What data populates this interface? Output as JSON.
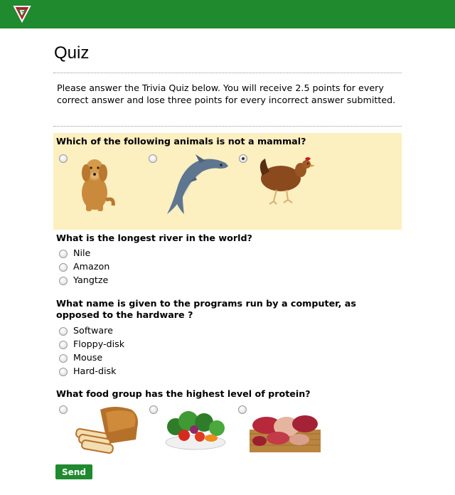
{
  "header": {
    "brand_color": "#1f8a2e",
    "logo_icon": "shield-logo-icon"
  },
  "page": {
    "title": "Quiz",
    "intro": "Please answer the Trivia Quiz below. You will receive 2.5 points for every correct answer and lose three points for every incorrect answer submitted."
  },
  "questions": [
    {
      "text": "Which of the following animals is not a mammal?",
      "options": [
        {
          "picture": "dog-image",
          "selected": false
        },
        {
          "picture": "dolphin-image",
          "selected": false
        },
        {
          "picture": "chicken-image",
          "selected": true
        }
      ]
    },
    {
      "text": "What is the longest river in the world?",
      "options": [
        {
          "label": "Nile"
        },
        {
          "label": "Amazon"
        },
        {
          "label": "Yangtze"
        }
      ]
    },
    {
      "text": "What name is given to the programs run by a computer, as opposed to the hardware ?",
      "options": [
        {
          "label": "Software"
        },
        {
          "label": "Floppy-disk"
        },
        {
          "label": "Mouse"
        },
        {
          "label": "Hard-disk"
        }
      ]
    },
    {
      "text": "What food group has the highest level of protein?",
      "options": [
        {
          "picture": "bread-image",
          "selected": false
        },
        {
          "picture": "vegetables-image",
          "selected": false
        },
        {
          "picture": "meat-image",
          "selected": false
        }
      ]
    }
  ],
  "actions": {
    "send_label": "Send"
  }
}
